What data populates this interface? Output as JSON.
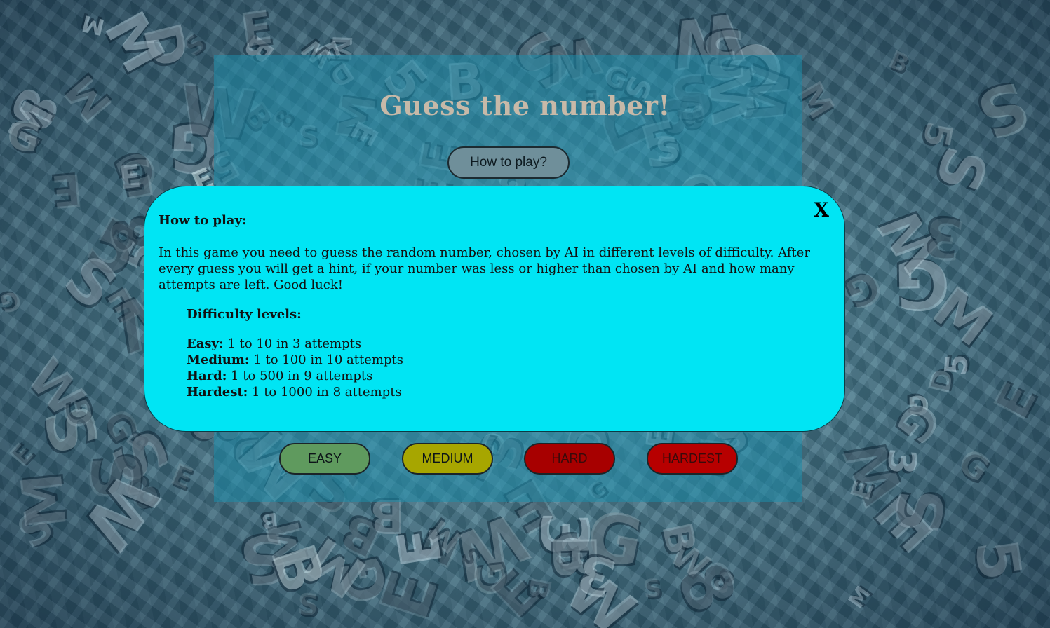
{
  "game": {
    "title": "Guess the number!",
    "how_to_button": "How to play?"
  },
  "modal": {
    "close_label": "X",
    "heading": "How to play:",
    "description": "In this game you need to guess the random number, chosen by AI in different levels of difficulty. After every guess you will get a hint, if your number was less or higher than chosen by AI and how many attempts are left. Good luck!",
    "levels_heading": "Difficulty levels:",
    "levels": [
      {
        "name": "Easy:",
        "detail": " 1 to 10 in 3 attempts"
      },
      {
        "name": "Medium:",
        "detail": " 1 to 100 in 10 attempts"
      },
      {
        "name": "Hard:",
        "detail": " 1 to 500 in 9 attempts"
      },
      {
        "name": "Hardest:",
        "detail": " 1 to 1000 in 8 attempts"
      }
    ]
  },
  "difficulty_buttons": {
    "easy": "EASY",
    "medium": "MEDIUM",
    "hard": "HARD",
    "hardest": "HARDEST"
  },
  "colors": {
    "modal_bg": "#00e5f4",
    "easy": "#5f9a5e",
    "medium": "#a7a600",
    "hard": "#a70000",
    "hardest": "#b70000"
  }
}
